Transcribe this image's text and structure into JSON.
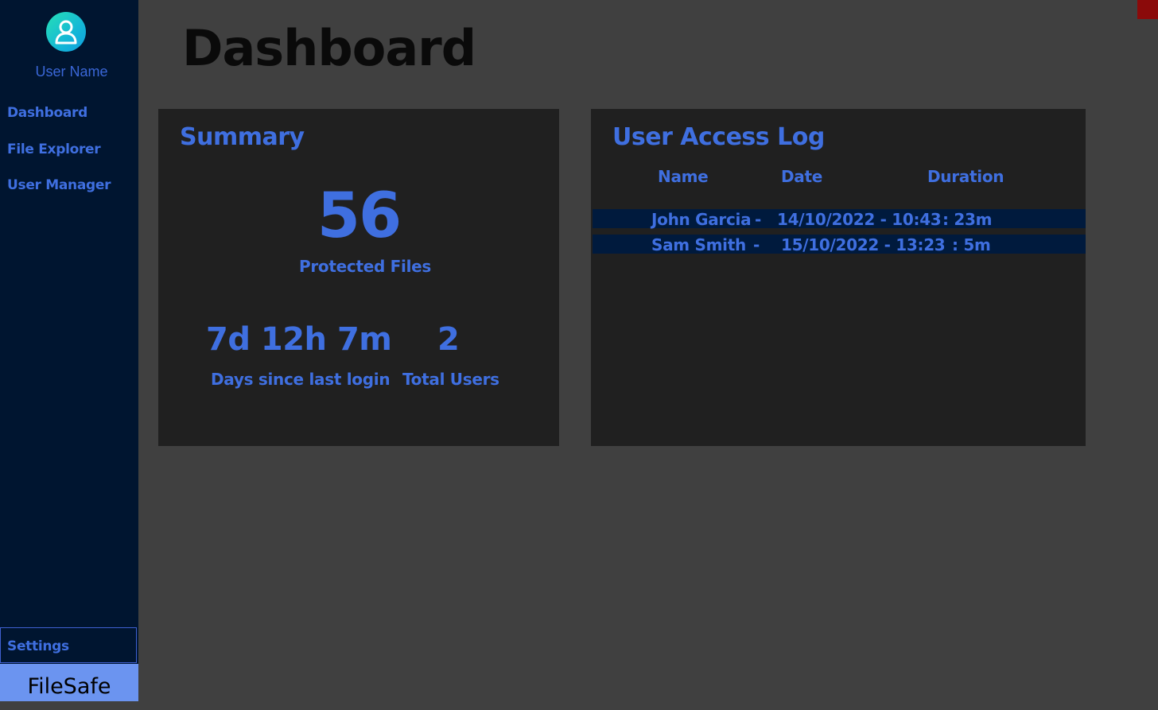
{
  "sidebar": {
    "user_name": "User Name",
    "nav": [
      "Dashboard",
      "File Explorer",
      "User Manager"
    ],
    "settings_label": "Settings",
    "brand": "FileSafe"
  },
  "page": {
    "title": "Dashboard"
  },
  "summary": {
    "title": "Summary",
    "protected_files_count": "56",
    "protected_files_label": "Protected Files",
    "since_last_login_value": "7d 12h 7m",
    "since_last_login_label": "Days since last login",
    "total_users_value": "2",
    "total_users_label": "Total Users"
  },
  "access_log": {
    "title": "User Access Log",
    "columns": [
      "Name",
      "Date",
      "Duration"
    ],
    "rows": [
      {
        "name": "John Garcia",
        "sep": "-",
        "date": "14/10/2022 - 10:43",
        "duration": ": 23m"
      },
      {
        "name": "Sam Smith",
        "sep": "-",
        "date": "15/10/2022 - 13:23",
        "duration": ": 5m"
      }
    ]
  },
  "colors": {
    "accent": "#3f6fe0",
    "sidebar_bg": "#001530",
    "panel_bg": "#202020",
    "page_bg": "#404040",
    "brand_bg": "#6b94f0",
    "row_bg": "#001a3d",
    "close_red": "#8b0a0a"
  },
  "icons": {
    "avatar": "user-avatar-icon"
  }
}
